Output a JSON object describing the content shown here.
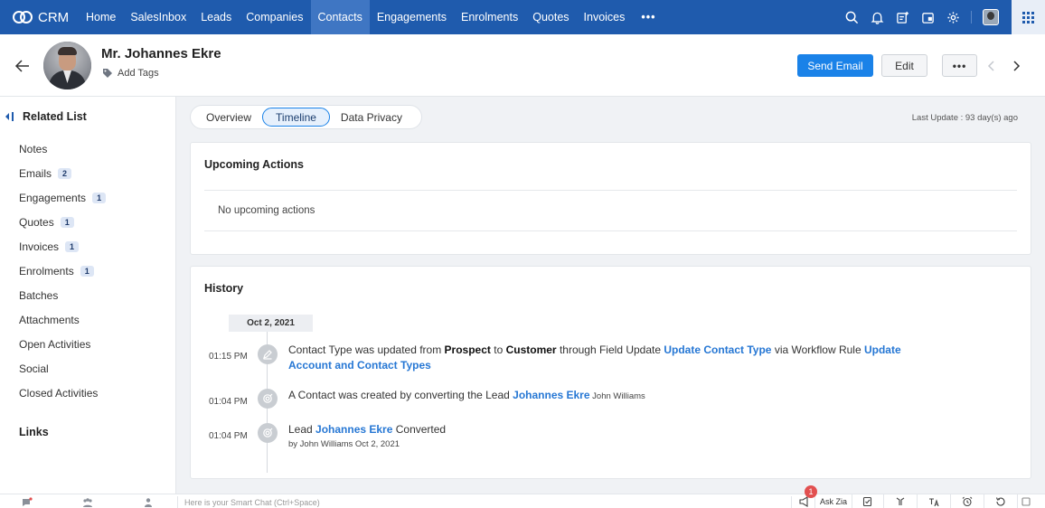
{
  "topnav": {
    "brand": "CRM",
    "items": [
      {
        "label": "Home",
        "active": false
      },
      {
        "label": "SalesInbox",
        "active": false
      },
      {
        "label": "Leads",
        "active": false
      },
      {
        "label": "Companies",
        "active": false
      },
      {
        "label": "Contacts",
        "active": true
      },
      {
        "label": "Engagements",
        "active": false
      },
      {
        "label": "Enrolments",
        "active": false
      },
      {
        "label": "Quotes",
        "active": false
      },
      {
        "label": "Invoices",
        "active": false
      }
    ],
    "more_label": "•••",
    "icons": [
      "search-icon",
      "bell-icon",
      "new-note-icon",
      "calendar-icon",
      "gear-icon",
      "avatar",
      "apps-grid-icon"
    ]
  },
  "record": {
    "name": "Mr. Johannes Ekre",
    "add_tags": "Add Tags",
    "send_email": "Send Email",
    "edit": "Edit",
    "more": "•••"
  },
  "sidebar": {
    "title": "Related List",
    "items": [
      {
        "label": "Notes",
        "count": null
      },
      {
        "label": "Emails",
        "count": "2"
      },
      {
        "label": "Engagements",
        "count": "1"
      },
      {
        "label": "Quotes",
        "count": "1"
      },
      {
        "label": "Invoices",
        "count": "1"
      },
      {
        "label": "Enrolments",
        "count": "1"
      },
      {
        "label": "Batches",
        "count": null
      },
      {
        "label": "Attachments",
        "count": null
      },
      {
        "label": "Open Activities",
        "count": null
      },
      {
        "label": "Social",
        "count": null
      },
      {
        "label": "Closed Activities",
        "count": null
      }
    ],
    "links": "Links"
  },
  "tabs": [
    {
      "label": "Overview",
      "active": false
    },
    {
      "label": "Timeline",
      "active": true
    },
    {
      "label": "Data Privacy",
      "active": false
    }
  ],
  "last_update": "Last Update : 93 day(s) ago",
  "upcoming": {
    "title": "Upcoming Actions",
    "empty": "No upcoming actions"
  },
  "history": {
    "title": "History",
    "date": "Oct 2, 2021",
    "events": [
      {
        "time": "01:15 PM",
        "icon": "pencil-icon",
        "parts": [
          {
            "t": "Contact Type was updated from ",
            "s": "plain"
          },
          {
            "t": "Prospect",
            "s": "bold"
          },
          {
            "t": " to ",
            "s": "plain"
          },
          {
            "t": "Customer",
            "s": "bold"
          },
          {
            "t": " through Field Update ",
            "s": "plain"
          },
          {
            "t": "Update Contact Type",
            "s": "link"
          },
          {
            "t": " via Workflow Rule ",
            "s": "plain"
          },
          {
            "t": "Update Account and Contact Types",
            "s": "link"
          }
        ],
        "sub": ""
      },
      {
        "time": "01:04 PM",
        "icon": "convert-icon",
        "parts": [
          {
            "t": "A Contact was created by converting the Lead ",
            "s": "plain"
          },
          {
            "t": "Johannes Ekre",
            "s": "link"
          },
          {
            "t": " John Williams",
            "s": "small"
          }
        ],
        "sub": ""
      },
      {
        "time": "01:04 PM",
        "icon": "convert-icon",
        "parts": [
          {
            "t": "Lead ",
            "s": "plain"
          },
          {
            "t": "Johannes Ekre",
            "s": "link"
          },
          {
            "t": " Converted",
            "s": "plain"
          }
        ],
        "sub": "by John Williams Oct 2, 2021"
      }
    ]
  },
  "bottombar": {
    "chat_placeholder": "Here is your Smart Chat (Ctrl+Space)",
    "ask_zia": "Ask Zia",
    "notification_count": "1"
  }
}
